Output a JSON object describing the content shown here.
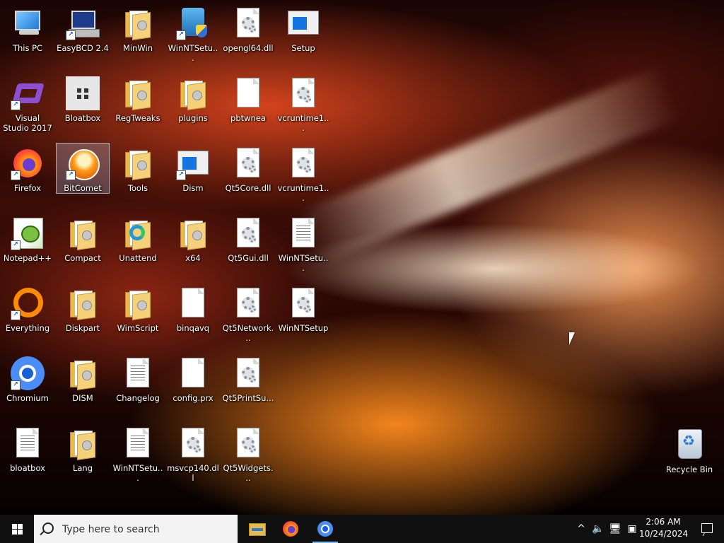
{
  "desktop_icons": [
    {
      "label": "This PC",
      "kind": "this-pc",
      "shortcut": false
    },
    {
      "label": "EasyBCD 2.4",
      "kind": "easybcd",
      "shortcut": true
    },
    {
      "label": "MinWin",
      "kind": "folder",
      "shortcut": false
    },
    {
      "label": "WinNTSetu...",
      "kind": "winntsetup",
      "shortcut": true
    },
    {
      "label": "opengl64.dll",
      "kind": "dll",
      "shortcut": false
    },
    {
      "label": "Setup",
      "kind": "window",
      "shortcut": false
    },
    {
      "label": "Visual Studio 2017",
      "kind": "visual-studio",
      "shortcut": true
    },
    {
      "label": "Bloatbox",
      "kind": "bloatbox",
      "shortcut": false
    },
    {
      "label": "RegTweaks",
      "kind": "folder",
      "shortcut": false
    },
    {
      "label": "plugins",
      "kind": "folder",
      "shortcut": false
    },
    {
      "label": "pbtwnea",
      "kind": "file",
      "shortcut": false
    },
    {
      "label": "vcruntime1...",
      "kind": "dll",
      "shortcut": false
    },
    {
      "label": "Firefox",
      "kind": "firefox",
      "shortcut": true
    },
    {
      "label": "BitComet",
      "kind": "bitcomet",
      "shortcut": true,
      "selected": true
    },
    {
      "label": "Tools",
      "kind": "folder",
      "shortcut": false
    },
    {
      "label": "Dism",
      "kind": "window",
      "shortcut": true
    },
    {
      "label": "Qt5Core.dll",
      "kind": "dll",
      "shortcut": false
    },
    {
      "label": "vcruntime1...",
      "kind": "dll",
      "shortcut": false
    },
    {
      "label": "Notepad++",
      "kind": "notepadpp",
      "shortcut": true
    },
    {
      "label": "Compact",
      "kind": "folder",
      "shortcut": false
    },
    {
      "label": "Unattend",
      "kind": "unattend",
      "shortcut": false
    },
    {
      "label": "x64",
      "kind": "folder",
      "shortcut": false
    },
    {
      "label": "Qt5Gui.dll",
      "kind": "dll",
      "shortcut": false
    },
    {
      "label": "WinNTSetu...",
      "kind": "text-file",
      "shortcut": false
    },
    {
      "label": "Everything",
      "kind": "everything",
      "shortcut": true
    },
    {
      "label": "Diskpart",
      "kind": "folder",
      "shortcut": false
    },
    {
      "label": "WimScript",
      "kind": "folder",
      "shortcut": false
    },
    {
      "label": "binqavq",
      "kind": "file",
      "shortcut": false
    },
    {
      "label": "Qt5Network...",
      "kind": "dll",
      "shortcut": false
    },
    {
      "label": "WinNTSetup",
      "kind": "config",
      "shortcut": false
    },
    {
      "label": "Chromium",
      "kind": "chromium",
      "shortcut": true
    },
    {
      "label": "DISM",
      "kind": "folder",
      "shortcut": false
    },
    {
      "label": "Changelog",
      "kind": "text-file",
      "shortcut": false
    },
    {
      "label": "config.prx",
      "kind": "file",
      "shortcut": false
    },
    {
      "label": "Qt5PrintSu...",
      "kind": "dll",
      "shortcut": false
    },
    {
      "label": "",
      "kind": "none",
      "shortcut": false
    },
    {
      "label": "bloatbox",
      "kind": "text-file",
      "shortcut": false
    },
    {
      "label": "Lang",
      "kind": "folder",
      "shortcut": false
    },
    {
      "label": "WinNTSetu...",
      "kind": "text-file",
      "shortcut": false
    },
    {
      "label": "msvcp140.dll",
      "kind": "dll",
      "shortcut": false
    },
    {
      "label": "Qt5Widgets...",
      "kind": "dll",
      "shortcut": false
    },
    {
      "label": "",
      "kind": "none",
      "shortcut": false
    }
  ],
  "recycle_bin": {
    "label": "Recycle Bin",
    "icon": "recycle-bin-icon"
  },
  "taskbar": {
    "search_placeholder": "Type here to search",
    "pinned": [
      {
        "name": "file-explorer",
        "icon": "folder-icon",
        "active": false
      },
      {
        "name": "firefox",
        "icon": "firefox-icon",
        "active": false
      },
      {
        "name": "chromium",
        "icon": "chromium-icon",
        "active": true
      }
    ],
    "tray": {
      "chevron": "^",
      "volume_icon": "volume-muted-icon",
      "network_icon": "network-icon",
      "display_icon": "display-icon"
    },
    "clock": {
      "time": "2:06 AM",
      "date": "10/24/2024"
    }
  },
  "colors": {
    "taskbar_bg": "#101010",
    "search_bg": "#f3f3f3",
    "accent": "#76b9ed"
  }
}
